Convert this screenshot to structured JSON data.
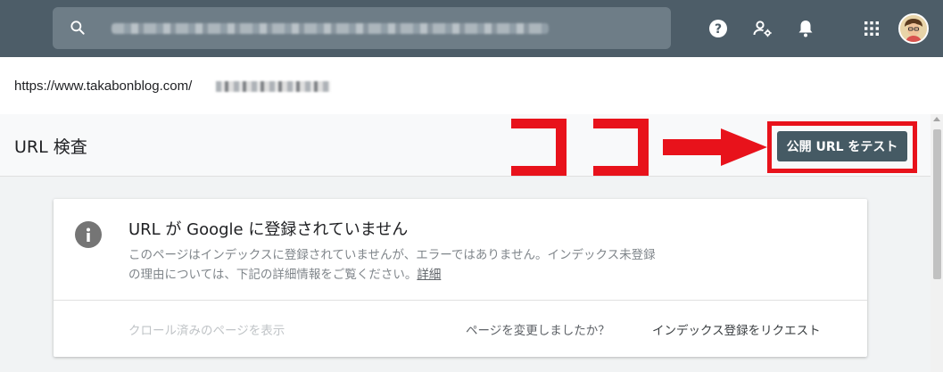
{
  "topbar": {
    "search_placeholder": "",
    "icons": [
      "search-icon",
      "help-icon",
      "manage-users-icon",
      "notifications-icon",
      "apps-icon",
      "avatar"
    ]
  },
  "url_bar": {
    "url_prefix": "https://www.takabonblog.com/"
  },
  "page": {
    "title": "URL 検査",
    "test_live_button": "公開 URL をテスト",
    "annotation_text": "ココ"
  },
  "card": {
    "heading": "URL が Google に登録されていません",
    "description": "このページはインデックスに登録されていませんが、エラーではありません。インデックス未登録の理由については、下記の詳細情報をご覧ください。",
    "details_link": "詳細",
    "view_crawled": "クロール済みのページを表示",
    "page_changed": "ページを変更しましたか？",
    "request_indexing": "インデックス登録をリクエスト"
  },
  "colors": {
    "topbar": "#4d5d68",
    "button": "#455a64",
    "annotation_red": "#e8121b"
  }
}
